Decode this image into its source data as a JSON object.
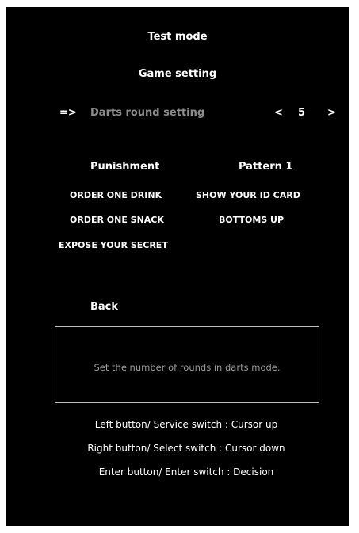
{
  "header": {
    "title": "Test mode",
    "subtitle": "Game setting"
  },
  "setting_row": {
    "cursor": "=>",
    "label": "Darts round setting",
    "left_arrow": "<",
    "value": "5",
    "right_arrow": ">"
  },
  "punishment": {
    "label": "Punishment",
    "pattern": "Pattern 1",
    "items": [
      "ORDER ONE DRINK",
      "SHOW YOUR ID CARD",
      "ORDER ONE SNACK",
      "BOTTOMS UP",
      "EXPOSE YOUR SECRET"
    ]
  },
  "back_label": "Back",
  "help": {
    "text": "Set the number of rounds in darts mode."
  },
  "controls": [
    "Left button/ Service switch : Cursor up",
    "Right button/ Select switch : Cursor down",
    "Enter button/ Enter switch : Decision"
  ],
  "colors": {
    "background": "#000000",
    "text": "#ffffff",
    "dim_text": "#8c8c8c",
    "box_border": "#bdbdbd"
  }
}
